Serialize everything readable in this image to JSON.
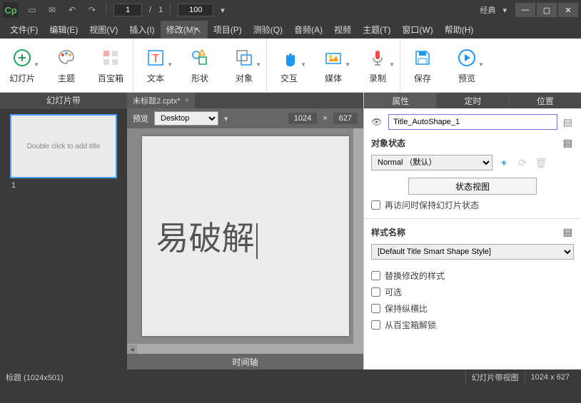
{
  "titlebar": {
    "logo": "Cp",
    "page_current": "1",
    "page_sep": "/",
    "page_total": "1",
    "zoom": "100",
    "workspace": "经典"
  },
  "menu": {
    "file": "文件(F)",
    "edit": "编辑(E)",
    "view": "视图(V)",
    "insert": "插入(I)",
    "modify": "修改(M)",
    "project": "项目(P)",
    "quiz": "测验(Q)",
    "audio": "音频(A)",
    "video": "视频",
    "theme": "主题(T)",
    "window": "窗口(W)",
    "help": "帮助(H)"
  },
  "ribbon": {
    "slides": "幻灯片",
    "themes": "主题",
    "assets": "百宝箱",
    "text": "文本",
    "shapes": "形状",
    "objects": "对象",
    "interactions": "交互",
    "media": "媒体",
    "record": "录制",
    "save": "保存",
    "preview": "预览"
  },
  "slidepanel": {
    "tab": "幻灯片带",
    "thumb_text": "Double click to add title",
    "number": "1"
  },
  "center": {
    "doc_name": "未标题2.cptx*",
    "preview_label": "预览",
    "device": "Desktop",
    "width": "1024",
    "times": "×",
    "height": "627",
    "canvas_text": "易破解",
    "timeline": "时间轴"
  },
  "props": {
    "tab_properties": "属性",
    "tab_timing": "定时",
    "tab_position": "位置",
    "object_name": "Title_AutoShape_1",
    "section_objectstate": "对象状态",
    "state_value": "Normal （默认）",
    "state_view_btn": "状态视图",
    "cb_revisit": "再访问时保持幻灯片状态",
    "section_stylename": "样式名称",
    "style_value": "[Default Title Smart Shape Style]",
    "cb_replace": "替换修改的样式",
    "cb_optional": "可选",
    "cb_aspect": "保持纵横比",
    "cb_unlock": "从百宝箱解锁"
  },
  "status": {
    "left": "标题 (1024x501)",
    "view": "幻灯片带视图",
    "dims": "1024 x 627"
  }
}
